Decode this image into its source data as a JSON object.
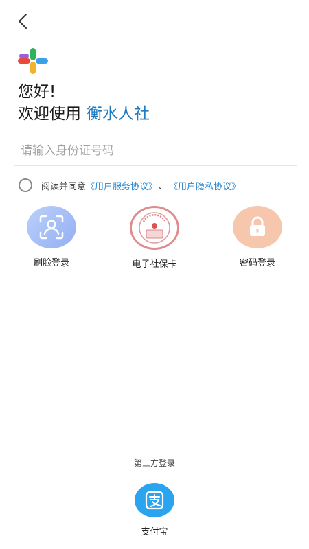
{
  "greeting": "您好!",
  "welcome_prefix": "欢迎使用",
  "app_name": "衡水人社",
  "id_input": {
    "placeholder": "请输入身份证号码",
    "value": ""
  },
  "agreement": {
    "prefix": "阅读并同意",
    "service_link": "《用户服务协议》",
    "separator": "、",
    "privacy_link": "《用户隐私协议》",
    "checked": false
  },
  "login_options": [
    {
      "label": "刷脸登录",
      "icon": "face-scan-icon",
      "color": "#9db7f5"
    },
    {
      "label": "电子社保卡",
      "icon": "social-security-card-icon",
      "color": "#e08c8c"
    },
    {
      "label": "密码登录",
      "icon": "lock-icon",
      "color": "#f6c7ad"
    }
  ],
  "third_party": {
    "title": "第三方登录",
    "items": [
      {
        "label": "支付宝",
        "icon": "alipay-icon",
        "color": "#2aa4ee"
      }
    ]
  },
  "colors": {
    "brand": "#1e7bc1",
    "link": "#2a86d0"
  }
}
